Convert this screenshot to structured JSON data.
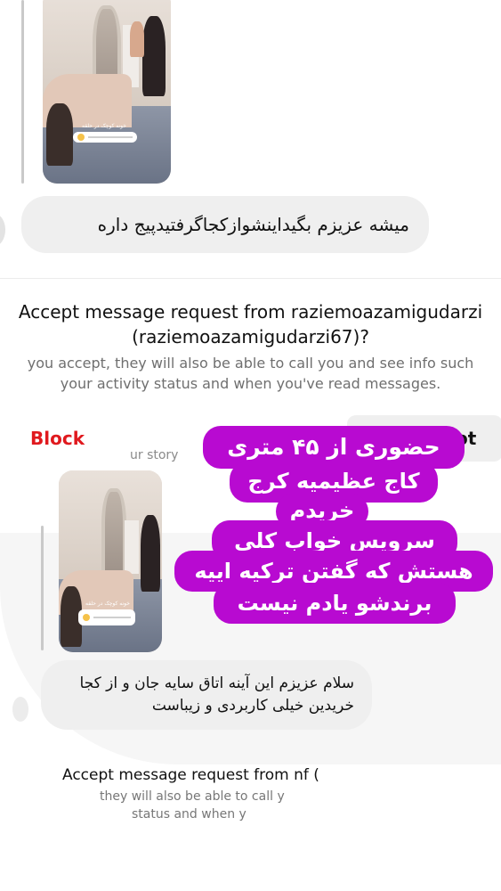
{
  "top_section": {
    "story_poll_caption": "خونه کوچک در حلقه",
    "message": "میشه عزیزم بگیداینشوازکجاگرفتیدپیج داره"
  },
  "request": {
    "title_line1": "Accept message request from raziemoazamigudarzi",
    "title_line2": "(raziemoazamigudarzi67)?",
    "desc_line1": "you accept, they will also be able to call you and see info such",
    "desc_line2": "your activity status and when you've read messages.",
    "block_label": "Block",
    "accept_label_partial": "ot"
  },
  "lower_section": {
    "story_label_partial": "ur story",
    "story_poll_caption": "خونه کوچک در حلقه",
    "message_line1": "سلام عزیزم این آینه اتاق سایه جان و از کجا",
    "message_line2": "خریدین خیلی کاربردی و زیباست",
    "request_title_partial": "Accept message request from nf (",
    "request_desc1_partial": "they will also be able to call y",
    "request_desc2_partial": "status and when y"
  },
  "overlay": {
    "lines": [
      "حضوری از ۴۵ متری",
      "کاج عظیمیه کرج",
      "خریدم",
      "سرویس خواب کلی",
      "هستش که گفتن ترکیه اییه",
      "برندشو یادم نیست"
    ],
    "color": "#b80ad1"
  },
  "colors": {
    "block": "#e0191e",
    "bubble": "#efefef"
  }
}
